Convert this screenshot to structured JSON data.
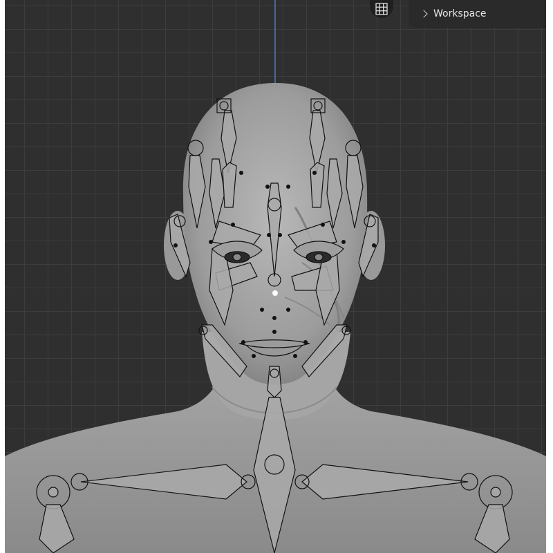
{
  "header": {
    "workspace_label": "Workspace"
  },
  "icons": {
    "grid_toggle": "grid-icon",
    "workspace_expand": "chevron-right-icon"
  },
  "colors": {
    "viewport_bg": "#2f2f2f",
    "grid_line": "#3d3d3d",
    "z_axis": "#4a7fd0",
    "mesh": "#9a9a9a",
    "bone_fill": "#a8a8a8",
    "bone_outline": "#111111"
  }
}
